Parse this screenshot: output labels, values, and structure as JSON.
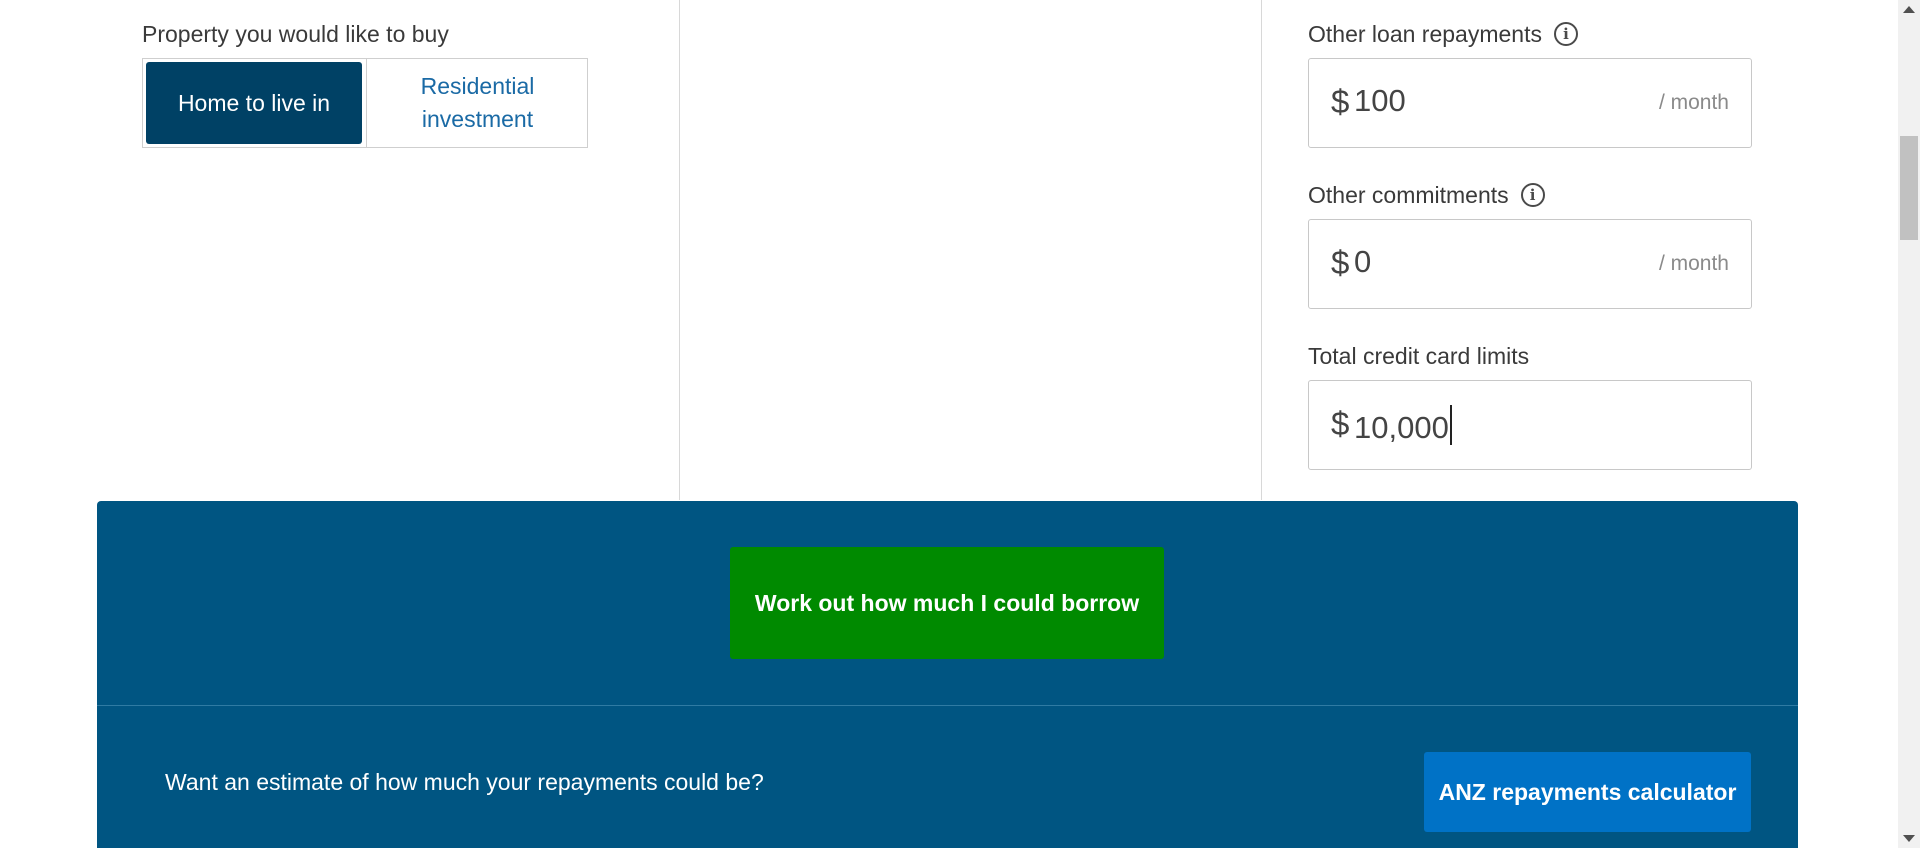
{
  "property": {
    "label": "Property you would like to buy",
    "options": [
      "Home to live in",
      "Residential investment"
    ],
    "selected": "Home to live in"
  },
  "fields": {
    "other_loan": {
      "label": "Other loan repayments",
      "currency": "$",
      "value": "100",
      "unit": "/ month"
    },
    "other_commitments": {
      "label": "Other commitments",
      "currency": "$",
      "value": "0",
      "unit": "/ month"
    },
    "credit_limits": {
      "label": "Total credit card limits",
      "currency": "$",
      "value": "10,000"
    }
  },
  "info_glyph": "i",
  "panel": {
    "cta_label": "Work out how much I could borrow",
    "prompt": "Want an estimate of how much your repayments could be?",
    "calculator_label": "ANZ repayments calculator"
  },
  "colors": {
    "brand_blue": "#004165",
    "panel_blue": "#005582",
    "cta_green": "#008a00",
    "link_blue": "#0072c6"
  },
  "icons": {
    "info": "info-icon"
  }
}
